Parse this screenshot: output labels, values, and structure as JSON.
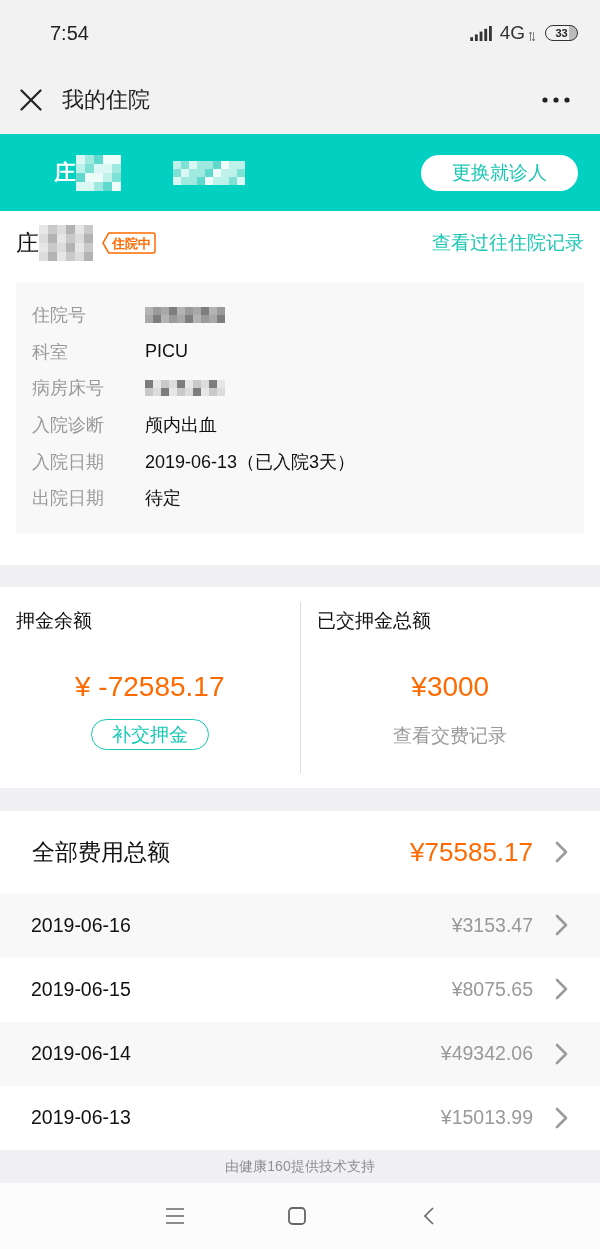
{
  "status_bar": {
    "time": "7:54",
    "network": "4G",
    "battery": "33"
  },
  "title_bar": {
    "title": "我的住院"
  },
  "patient_header": {
    "name": "庄",
    "button": "更换就诊人"
  },
  "admission": {
    "name": "庄",
    "status_tag": "住院中",
    "history_link": "查看过往住院记录",
    "details": [
      {
        "label": "住院号",
        "kind": "redacted"
      },
      {
        "label": "科室",
        "kind": "text",
        "value": "PICU"
      },
      {
        "label": "病房床号",
        "kind": "redacted"
      },
      {
        "label": "入院诊断",
        "kind": "text",
        "value": "颅内出血"
      },
      {
        "label": "入院日期",
        "kind": "text",
        "value": "2019-06-13（已入院3天）"
      },
      {
        "label": "出院日期",
        "kind": "text",
        "value": "待定"
      }
    ]
  },
  "deposit": {
    "balance": {
      "label": "押金余额",
      "amount": "¥ -72585.17",
      "button": "补交押金"
    },
    "paid": {
      "label": "已交押金总额",
      "amount": "¥3000",
      "link": "查看交费记录"
    }
  },
  "fees": {
    "total_label": "全部费用总额",
    "total_amount": "¥75585.17",
    "days": [
      {
        "date": "2019-06-16",
        "amount": "¥3153.47"
      },
      {
        "date": "2019-06-15",
        "amount": "¥8075.65"
      },
      {
        "date": "2019-06-14",
        "amount": "¥49342.06"
      },
      {
        "date": "2019-06-13",
        "amount": "¥15013.99"
      }
    ]
  },
  "footer": "由健康160提供技术支持"
}
